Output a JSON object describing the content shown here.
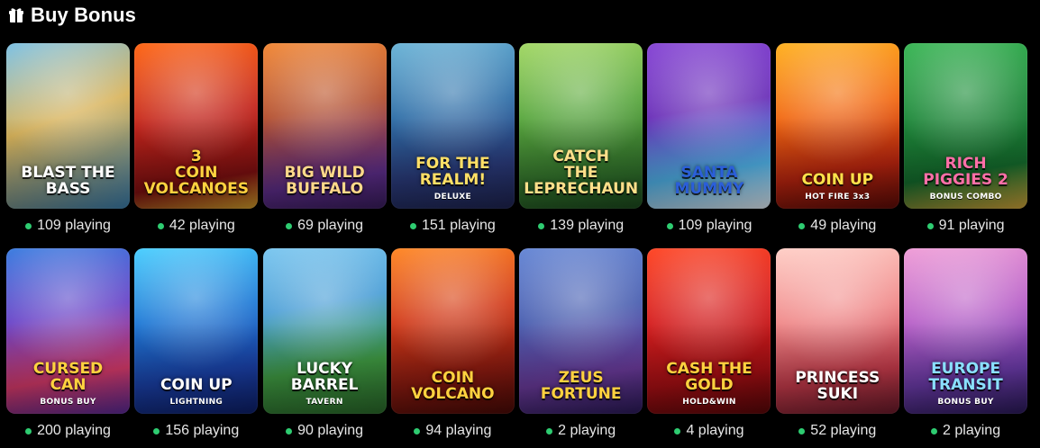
{
  "header": {
    "title": "Buy Bonus",
    "icon": "gift-icon"
  },
  "accent_color": "#2ecc71",
  "games": [
    {
      "title": "BLAST THE\nBASS",
      "sub": "",
      "players": "109 playing",
      "bg": "linear-gradient(160deg,#7fc3e6 0%,#d8b35a 45%,#3b7fae 100%)",
      "title_color": "#ffffff"
    },
    {
      "title": "3\nCOIN\nVOLCANOES",
      "sub": "",
      "players": "42 playing",
      "bg": "linear-gradient(170deg,#ff6a1a 0%,#c3251c 45%,#7d0f10 80%,#d6a12b 100%)",
      "title_color": "#ffd23f"
    },
    {
      "title": "BIG WILD\nBUFFALO",
      "sub": "",
      "players": "69 playing",
      "bg": "linear-gradient(170deg,#f28b3b 0%,#b4502f 40%,#5d2d8a 80%,#3a1d5f 100%)",
      "title_color": "#ffd98a"
    },
    {
      "title": "FOR THE\nREALM!",
      "sub": "DELUXE",
      "players": "151 playing",
      "bg": "linear-gradient(170deg,#6fb6d8 0%,#2f6fa8 40%,#2a3a7a 75%,#1e2451 100%)",
      "title_color": "#ffe066"
    },
    {
      "title": "CATCH\nTHE\nLEPRECHAUN",
      "sub": "",
      "players": "139 playing",
      "bg": "linear-gradient(170deg,#a6d96a 0%,#5aa83f 40%,#2f6f2a 80%,#1c4a1e 100%)",
      "title_color": "#ffe08a"
    },
    {
      "title": "SANTA\nMUMMY",
      "sub": "",
      "players": "109 playing",
      "bg": "linear-gradient(170deg,#8a4bd6 0%,#6a2fb8 40%,#4fb2e8 75%,#e9f3fb 100%)",
      "title_color": "#2b5fd9"
    },
    {
      "title": "COIN UP",
      "sub": "HOT FIRE 3x3",
      "players": "49 playing",
      "bg": "linear-gradient(170deg,#ffb326 0%,#f26a12 40%,#b8240f 75%,#5e0b07 100%)",
      "title_color": "#ffe14a"
    },
    {
      "title": "RICH\nPIGGIES 2",
      "sub": "BONUS COMBO",
      "players": "91 playing",
      "bg": "linear-gradient(170deg,#3fb85a 0%,#1f8a3b 40%,#146a2c 75%,#d7a83a 100%)",
      "title_color": "#ff6fa8"
    },
    {
      "title": "CURSED\nCAN",
      "sub": "BONUS BUY",
      "players": "200 playing",
      "bg": "linear-gradient(170deg,#3f7fe0 0%,#6a45c8 40%,#d63a6a 75%,#5a2a9a 100%)",
      "title_color": "#ffd23f"
    },
    {
      "title": "COIN UP",
      "sub": "LIGHTNING",
      "players": "156 playing",
      "bg": "linear-gradient(170deg,#4fd0ff 0%,#1f7ad6 40%,#1a3fa6 75%,#0d1f6a 100%)",
      "title_color": "#ffffff"
    },
    {
      "title": "LUCKY\nBARREL",
      "sub": "TAVERN",
      "players": "90 playing",
      "bg": "linear-gradient(170deg,#7ec8f0 0%,#4a9ed6 35%,#3f9a42 70%,#2a6a2a 100%)",
      "title_color": "#ffffff"
    },
    {
      "title": "COIN\nVOLCANO",
      "sub": "",
      "players": "94 playing",
      "bg": "linear-gradient(170deg,#ff8a2a 0%,#d23a18 40%,#8a1a10 75%,#4a0a06 100%)",
      "title_color": "#ffd23f"
    },
    {
      "title": "ZEUS\nFORTUNE",
      "sub": "",
      "players": "2 playing",
      "bg": "linear-gradient(170deg,#6a8ad6 0%,#4a5fb0 40%,#6a3a9a 75%,#2a1a5a 100%)",
      "title_color": "#ffd23f"
    },
    {
      "title": "CASH THE GOLD",
      "sub": "HOLD&WIN",
      "players": "4 playing",
      "bg": "linear-gradient(170deg,#ff4a2a 0%,#d61f1f 40%,#a80f14 75%,#5a0608 100%)",
      "title_color": "#ffd23f"
    },
    {
      "title": "PRINCESS\nSUKI",
      "sub": "",
      "players": "52 playing",
      "bg": "linear-gradient(170deg,#ffd0c8 0%,#f08a8a 40%,#c43a4a 75%,#6a1a2a 100%)",
      "title_color": "#ffffff"
    },
    {
      "title": "EUROPE\nTRANSIT",
      "sub": "BONUS BUY",
      "players": "2 playing",
      "bg": "linear-gradient(170deg,#f0a0d8 0%,#b860c8 40%,#6a3aa8 75%,#2a1a5a 100%)",
      "title_color": "#8ae0ff"
    }
  ]
}
